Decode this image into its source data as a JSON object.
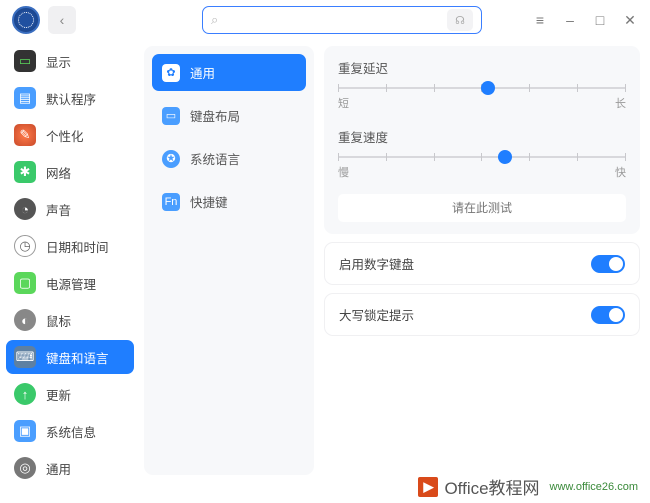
{
  "search": {
    "placeholder": ""
  },
  "sidebar": {
    "items": [
      {
        "label": "显示"
      },
      {
        "label": "默认程序"
      },
      {
        "label": "个性化"
      },
      {
        "label": "网络"
      },
      {
        "label": "声音"
      },
      {
        "label": "日期和时间"
      },
      {
        "label": "电源管理"
      },
      {
        "label": "鼠标"
      },
      {
        "label": "键盘和语言"
      },
      {
        "label": "更新"
      },
      {
        "label": "系统信息"
      },
      {
        "label": "通用"
      }
    ]
  },
  "subnav": {
    "items": [
      {
        "label": "通用"
      },
      {
        "label": "键盘布局"
      },
      {
        "label": "系统语言"
      },
      {
        "label": "快捷键"
      }
    ]
  },
  "panel": {
    "delay": {
      "title": "重复延迟",
      "min": "短",
      "max": "长",
      "value_pct": 52
    },
    "rate": {
      "title": "重复速度",
      "min": "慢",
      "max": "快",
      "value_pct": 58
    },
    "test_placeholder": "请在此测试",
    "numlock": "启用数字键盘",
    "capslock": "大写锁定提示"
  },
  "footer": {
    "brand": "Office",
    "suffix": "教程网",
    "url": "www.office26.com"
  }
}
